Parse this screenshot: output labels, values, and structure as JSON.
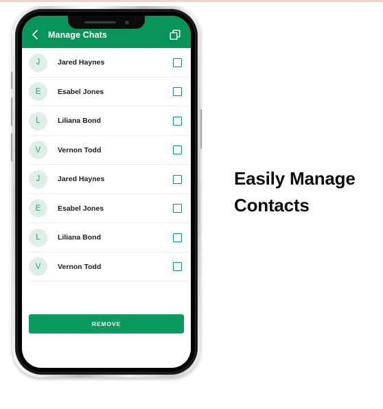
{
  "page": {
    "background_color": "#ffffff",
    "hairline_color": "#e6d6cd"
  },
  "theme": {
    "primary_green": "#07945a",
    "button_green": "#0b9a5f",
    "avatar_bg": "#ddf0e6",
    "avatar_text": "#2c9e72",
    "divider": "#ececec",
    "text_dark": "#1a1a1a"
  },
  "device": {
    "notch": {
      "speaker_icon": "speaker-slit",
      "camera_icon": "front-camera-dot"
    },
    "buttons": {
      "mute": "mute-switch",
      "volume_up": "volume-up-button",
      "volume_down": "volume-down-button",
      "power": "power-button"
    }
  },
  "appbar": {
    "back_icon": "chevron-left-icon",
    "title": "Manage Chats",
    "action_icon": "copy-duplicate-icon"
  },
  "contacts": [
    {
      "initial": "J",
      "name": "Jared Haynes",
      "checked": false
    },
    {
      "initial": "E",
      "name": "Esabel Jones",
      "checked": false
    },
    {
      "initial": "L",
      "name": "Liliana Bond",
      "checked": false
    },
    {
      "initial": "V",
      "name": "Vernon Todd",
      "checked": false
    },
    {
      "initial": "J",
      "name": "Jared Haynes",
      "checked": false
    },
    {
      "initial": "E",
      "name": "Esabel Jones",
      "checked": false
    },
    {
      "initial": "L",
      "name": "Liliana Bond",
      "checked": false
    },
    {
      "initial": "V",
      "name": "Vernon Todd",
      "checked": false
    }
  ],
  "footer": {
    "remove_label": "REMOVE"
  },
  "caption": {
    "line1": "Easily Manage",
    "line2": "Contacts"
  }
}
